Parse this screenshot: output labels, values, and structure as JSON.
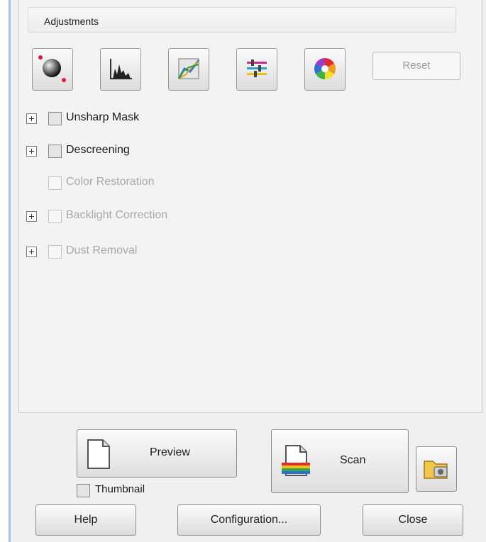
{
  "adjustments": {
    "title": "Adjustments",
    "tools": [
      {
        "icon": "auto-exposure-icon"
      },
      {
        "icon": "histogram-icon"
      },
      {
        "icon": "tone-curve-icon"
      },
      {
        "icon": "color-balance-icon"
      },
      {
        "icon": "color-palette-icon"
      }
    ],
    "reset_label": "Reset"
  },
  "options": [
    {
      "label": "Unsharp Mask",
      "expandable": true,
      "checked": false,
      "enabled": true
    },
    {
      "label": "Descreening",
      "expandable": true,
      "checked": false,
      "enabled": true
    },
    {
      "label": "Color Restoration",
      "expandable": false,
      "checked": false,
      "enabled": false
    },
    {
      "label": "Backlight Correction",
      "expandable": true,
      "checked": false,
      "enabled": false
    },
    {
      "label": "Dust Removal",
      "expandable": true,
      "checked": false,
      "enabled": false
    }
  ],
  "actions": {
    "preview_label": "Preview",
    "scan_label": "Scan",
    "thumbnail_label": "Thumbnail",
    "thumbnail_checked": false
  },
  "footer": {
    "help_label": "Help",
    "configuration_label": "Configuration...",
    "close_label": "Close"
  }
}
